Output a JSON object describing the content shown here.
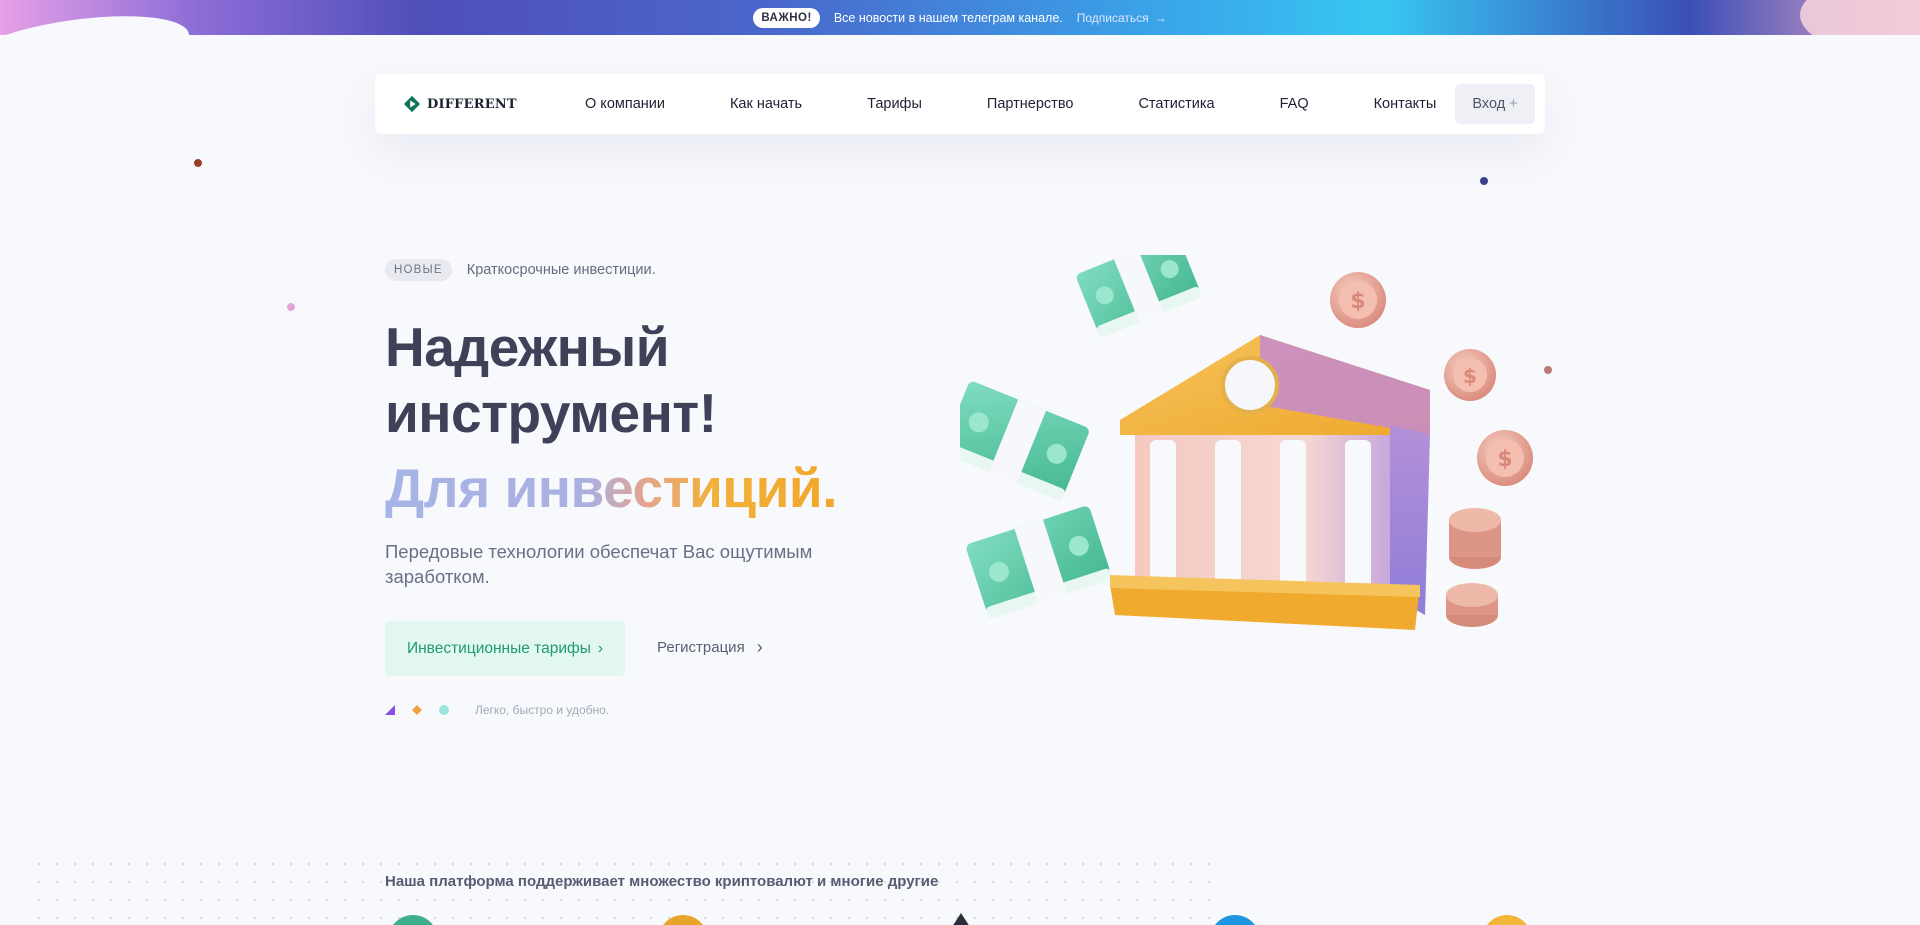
{
  "announcement": {
    "badge": "ВАЖНО!",
    "text": "Все новости в нашем телеграм канале.",
    "link_label": "Подписаться",
    "link_icon": "arrow-right-icon"
  },
  "nav": {
    "logo_text": "DIFFERENT",
    "items": [
      {
        "label": "О компании"
      },
      {
        "label": "Как начать"
      },
      {
        "label": "Тарифы"
      },
      {
        "label": "Партнерство"
      },
      {
        "label": "Статистика"
      },
      {
        "label": "FAQ"
      },
      {
        "label": "Контакты"
      }
    ],
    "login_label": "Вход",
    "login_icon": "plus-icon"
  },
  "hero": {
    "badge": "НОВЫЕ",
    "badge_text": "Краткосрочные инвестиции.",
    "title": "Надежный инструмент!",
    "subtitle": "Для инвестиций.",
    "lead": "Передовые технологии обеспечат Вас ощутимым заработком.",
    "primary_button": "Инвестиционные тарифы",
    "secondary_button": "Регистрация",
    "feature_text": "Легко, быстро и удобно."
  },
  "platform": {
    "title": "Наша платформа поддерживает множество криптовалют и многие другие"
  },
  "colors": {
    "accent_green": "#1f9a72",
    "accent_orange": "#f2a62a",
    "heading": "#3e4157"
  }
}
